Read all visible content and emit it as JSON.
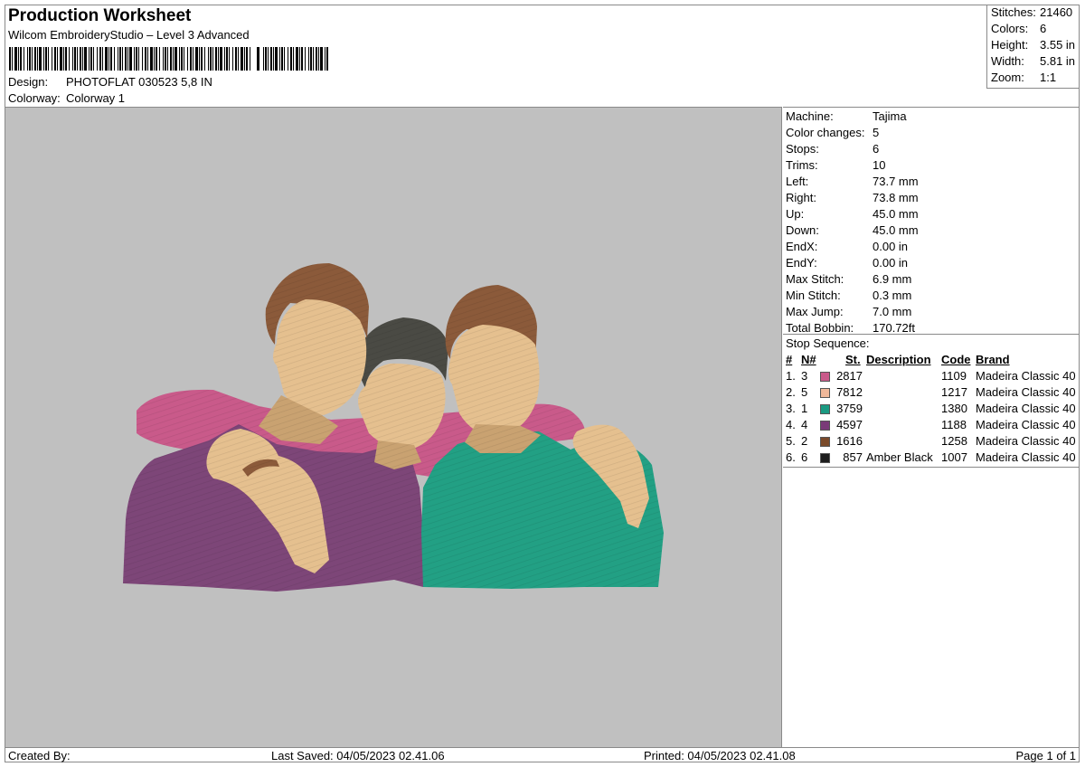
{
  "header": {
    "title": "Production Worksheet",
    "software": "Wilcom EmbroideryStudio – Level 3 Advanced",
    "design_label": "Design:",
    "design_value": "PHOTOFLAT 030523 5,8 IN",
    "colorway_label": "Colorway:",
    "colorway_value": "Colorway 1"
  },
  "stats": [
    {
      "label": "Stitches:",
      "value": "21460"
    },
    {
      "label": "Colors:",
      "value": "6"
    },
    {
      "label": "Height:",
      "value": "3.55 in"
    },
    {
      "label": "Width:",
      "value": "5.81 in"
    },
    {
      "label": "Zoom:",
      "value": "1:1"
    }
  ],
  "machine_info": [
    {
      "label": "Machine:",
      "value": "Tajima"
    },
    {
      "label": "Color changes:",
      "value": "5"
    },
    {
      "label": "Stops:",
      "value": "6"
    },
    {
      "label": "Trims:",
      "value": "10"
    },
    {
      "label": "Left:",
      "value": "73.7 mm"
    },
    {
      "label": "Right:",
      "value": "73.8 mm"
    },
    {
      "label": "Up:",
      "value": "45.0 mm"
    },
    {
      "label": "Down:",
      "value": "45.0 mm"
    },
    {
      "label": "EndX:",
      "value": "0.00 in"
    },
    {
      "label": "EndY:",
      "value": "0.00 in"
    },
    {
      "label": "Max Stitch:",
      "value": "6.9 mm"
    },
    {
      "label": "Min Stitch:",
      "value": "0.3 mm"
    },
    {
      "label": "Max Jump:",
      "value": "7.0 mm"
    },
    {
      "label": "Total Bobbin:",
      "value": "170.72ft"
    }
  ],
  "stop_sequence": {
    "title": "Stop Sequence:",
    "headers": {
      "stop": "#",
      "n": "N#",
      "st": "St.",
      "description": "Description",
      "code": "Code",
      "brand": "Brand"
    },
    "rows": [
      {
        "stop": "1.",
        "n": "3",
        "st": "2817",
        "description": "",
        "code": "1109",
        "brand": "Madeira Classic 40",
        "color": "#c95a8a"
      },
      {
        "stop": "2.",
        "n": "5",
        "st": "7812",
        "description": "",
        "code": "1217",
        "brand": "Madeira Classic 40",
        "color": "#f0b89a"
      },
      {
        "stop": "3.",
        "n": "1",
        "st": "3759",
        "description": "",
        "code": "1380",
        "brand": "Madeira Classic 40",
        "color": "#1a9a82"
      },
      {
        "stop": "4.",
        "n": "4",
        "st": "4597",
        "description": "",
        "code": "1188",
        "brand": "Madeira Classic 40",
        "color": "#7a3a78"
      },
      {
        "stop": "5.",
        "n": "2",
        "st": "1616",
        "description": "",
        "code": "1258",
        "brand": "Madeira Classic 40",
        "color": "#7a4a2a"
      },
      {
        "stop": "6.",
        "n": "6",
        "st": "857",
        "description": "Amber Black",
        "code": "1007",
        "brand": "Madeira Classic 40",
        "color": "#1e1e1e"
      }
    ]
  },
  "footer": {
    "created_by": "Created By:",
    "last_saved": "Last Saved: 04/05/2023 02.41.06",
    "printed": "Printed: 04/05/2023 02.41.08",
    "page": "Page 1 of 1"
  },
  "design_colors": {
    "background": "#c0c0c0",
    "skin": "#e5c08f",
    "skin_shadow": "#c9a271",
    "hair_brown": "#8b5a3a",
    "hair_dark": "#4a4a44",
    "shirt_pink": "#c95a8a",
    "shirt_purple": "#7d4678",
    "shirt_teal": "#22a084"
  }
}
